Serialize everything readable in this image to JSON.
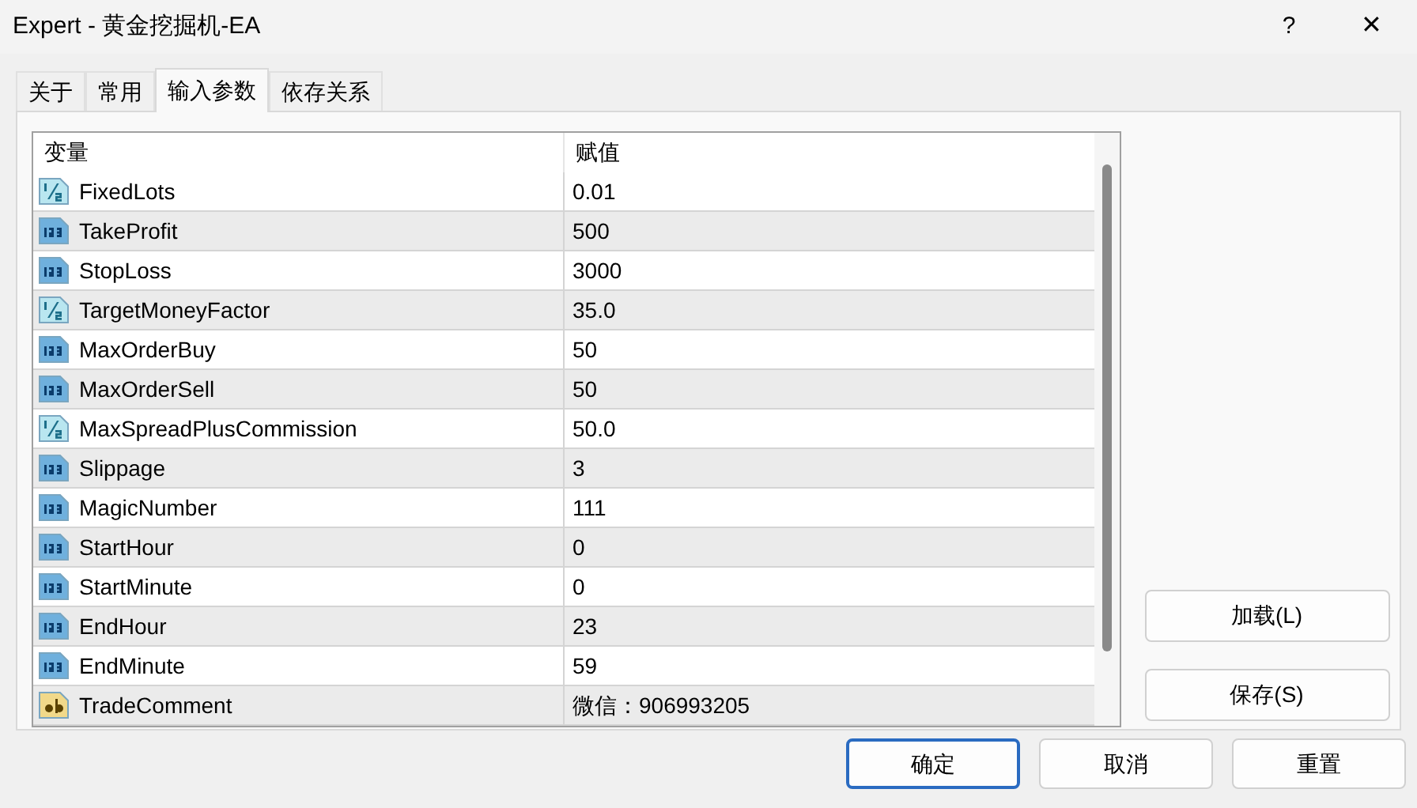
{
  "window": {
    "title": "Expert - 黄金挖掘机-EA",
    "help": "?",
    "close": "✕"
  },
  "tabs": [
    {
      "label": "关于",
      "selected": false
    },
    {
      "label": "常用",
      "selected": false
    },
    {
      "label": "输入参数",
      "selected": true
    },
    {
      "label": "依存关系",
      "selected": false
    }
  ],
  "table": {
    "columns": [
      "变量",
      "赋值"
    ],
    "rows": [
      {
        "kind": "double",
        "name": "FixedLots",
        "value": "0.01"
      },
      {
        "kind": "int",
        "name": "TakeProfit",
        "value": "500"
      },
      {
        "kind": "int",
        "name": "StopLoss",
        "value": "3000"
      },
      {
        "kind": "double",
        "name": "TargetMoneyFactor",
        "value": "35.0"
      },
      {
        "kind": "int",
        "name": "MaxOrderBuy",
        "value": "50"
      },
      {
        "kind": "int",
        "name": "MaxOrderSell",
        "value": "50"
      },
      {
        "kind": "double",
        "name": "MaxSpreadPlusCommission",
        "value": "50.0"
      },
      {
        "kind": "int",
        "name": "Slippage",
        "value": "3"
      },
      {
        "kind": "int",
        "name": "MagicNumber",
        "value": "111"
      },
      {
        "kind": "int",
        "name": "StartHour",
        "value": "0"
      },
      {
        "kind": "int",
        "name": "StartMinute",
        "value": "0"
      },
      {
        "kind": "int",
        "name": "EndHour",
        "value": "23"
      },
      {
        "kind": "int",
        "name": "EndMinute",
        "value": "59"
      },
      {
        "kind": "string",
        "name": "TradeComment",
        "value": "微信：906993205"
      }
    ]
  },
  "side_buttons": [
    "加载(L)",
    "保存(S)"
  ],
  "buttons": [
    {
      "label": "确定",
      "default": true
    },
    {
      "label": "取消",
      "default": false
    },
    {
      "label": "重置",
      "default": false
    }
  ]
}
